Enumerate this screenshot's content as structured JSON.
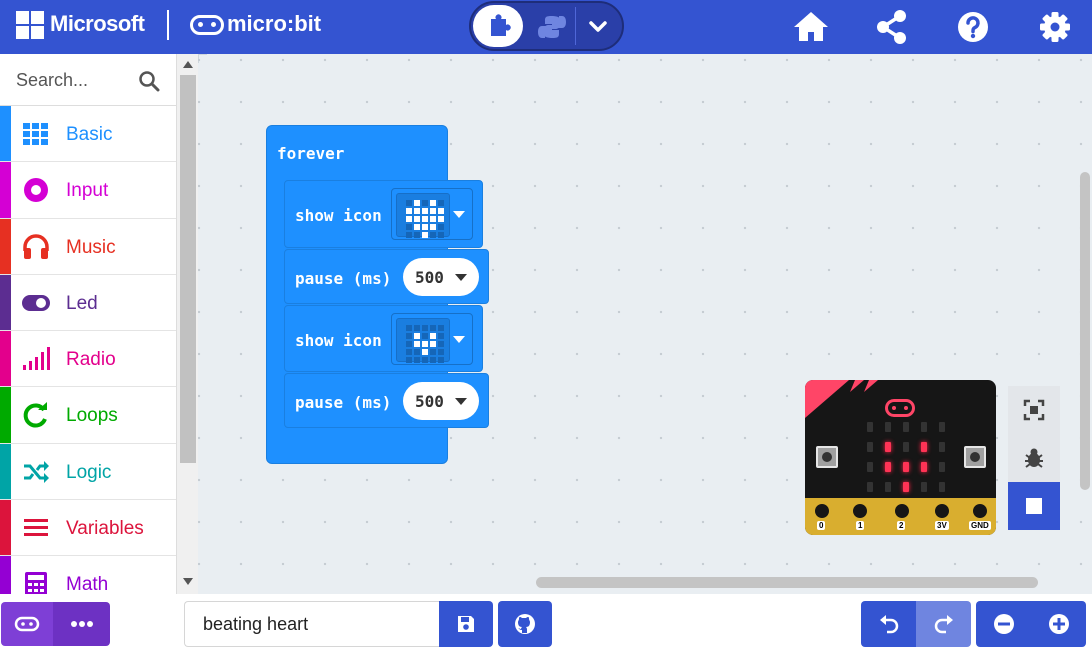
{
  "header": {
    "ms_label": "Microsoft",
    "mb_label": "micro:bit"
  },
  "toolbox": {
    "search_placeholder": "Search...",
    "categories": [
      {
        "label": "Basic",
        "color": "#1e90ff",
        "icon": "grid-icon"
      },
      {
        "label": "Input",
        "color": "#d400d4",
        "icon": "radio-dot-icon"
      },
      {
        "label": "Music",
        "color": "#e63022",
        "icon": "headphones-icon"
      },
      {
        "label": "Led",
        "color": "#5c2d91",
        "icon": "toggle-icon"
      },
      {
        "label": "Radio",
        "color": "#e3008c",
        "icon": "signal-bars-icon"
      },
      {
        "label": "Loops",
        "color": "#00aa00",
        "icon": "refresh-icon"
      },
      {
        "label": "Logic",
        "color": "#00a4a6",
        "icon": "shuffle-icon"
      },
      {
        "label": "Variables",
        "color": "#dc143c",
        "icon": "lines-icon"
      },
      {
        "label": "Math",
        "color": "#9400d3",
        "icon": "calculator-icon"
      }
    ]
  },
  "blocks": {
    "forever_label": "forever",
    "show1_label": "show icon",
    "pause1_label": "pause (ms)",
    "pause1_value": "500",
    "show2_label": "show icon",
    "pause2_label": "pause (ms)",
    "pause2_value": "500"
  },
  "simulator": {
    "pins": [
      "0",
      "1",
      "2",
      "3V",
      "GND"
    ]
  },
  "bottom": {
    "project_name": "beating heart"
  },
  "colors": {
    "header": "#3454d1",
    "block": "#1e90ff",
    "download": "#7e3fd6"
  }
}
